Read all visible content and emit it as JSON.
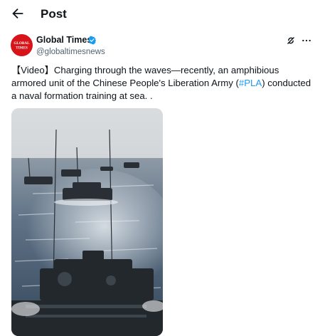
{
  "header": {
    "back_icon": "arrow-left-icon",
    "title": "Post"
  },
  "author": {
    "avatar_text_line1": "GLOBAL",
    "avatar_text_line2": "TIMES",
    "name": "Global Times",
    "handle": "@globaltimesnews",
    "verified_icon": "verified-badge-icon",
    "verified_color": "#1d9bf0",
    "avatar_color": "#d7141a"
  },
  "actions": {
    "grok_icon": "grok-icon",
    "more_icon": "more-dots-icon"
  },
  "post": {
    "text_before": "【Video】Charging through the waves—recently, an amphibious armored unit of the Chinese People's Liberation Army (",
    "hashtag": "#PLA",
    "text_after": ") conducted a naval formation training at sea. .",
    "hashtag_color": "#1d9bf0"
  },
  "media": {
    "type": "video-thumbnail"
  }
}
